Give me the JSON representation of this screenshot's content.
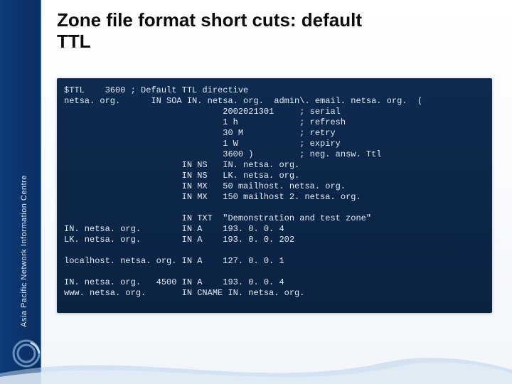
{
  "sidebar": {
    "org_text": "Asia Pacific Network Information Centre",
    "logo_label": "APNIC"
  },
  "title": {
    "line1": "Zone file format short cuts: default",
    "line2": "TTL"
  },
  "code": {
    "lines": [
      "$TTL    3600 ; Default TTL directive",
      "netsa. org.      IN SOA IN. netsa. org.  admin\\. email. netsa. org.  (",
      "                               2002021301     ; serial",
      "                               1 h            ; refresh",
      "                               30 M           ; retry",
      "                               1 W            ; expiry",
      "                               3600 )         ; neg. answ. Ttl",
      "                       IN NS   IN. netsa. org.",
      "                       IN NS   LK. netsa. org.",
      "                       IN MX   50 mailhost. netsa. org.",
      "                       IN MX   150 mailhost 2. netsa. org.",
      "",
      "                       IN TXT  \"Demonstration and test zone\"",
      "IN. netsa. org.        IN A    193. 0. 0. 4",
      "LK. netsa. org.        IN A    193. 0. 0. 202",
      "",
      "localhost. netsa. org. IN A    127. 0. 0. 1",
      "",
      "IN. netsa. org.   4500 IN A    193. 0. 0. 4",
      "www. netsa. org.       IN CNAME IN. netsa. org."
    ]
  },
  "colors": {
    "sidebar_dark": "#0a2f62",
    "sidebar_light": "#0d3a78",
    "code_bg_top": "#0e2a4f",
    "code_bg_bottom": "#0b2342",
    "code_text": "#e2ecf7",
    "title_text": "#0b0b0b"
  }
}
